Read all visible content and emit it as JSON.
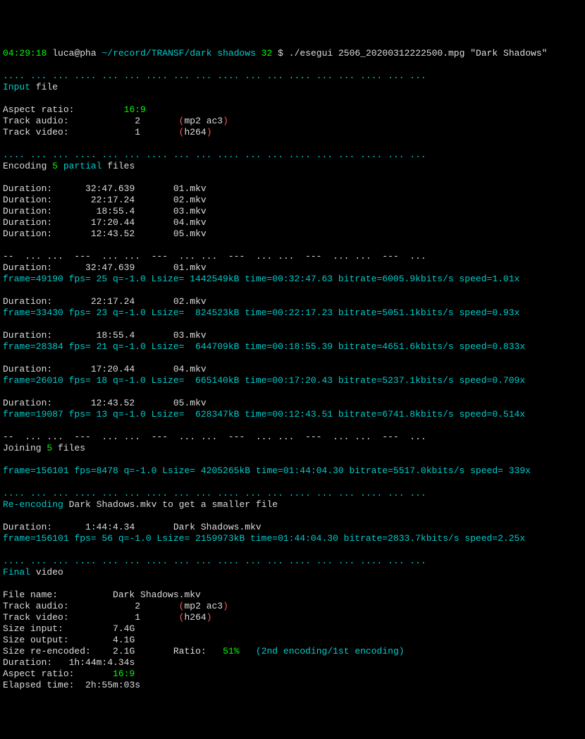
{
  "prompt": {
    "time": "04:29:18",
    "user": "luca@pha",
    "path": "~/record/TRANSF/dark shadows",
    "num": "32",
    "dollar": "$",
    "cmd": "./esegui 2506_20200312222500.mpg \"Dark Shadows\""
  },
  "dots": ".... ... ... .... ... ... .... ... ... .... ... ... .... ... ... .... ... ...",
  "section_input": {
    "label": "Input",
    "word": "file"
  },
  "aspect": {
    "label": "Aspect ratio:",
    "val": "16:9"
  },
  "track_audio": {
    "label": "Track audio:",
    "val": "2",
    "open": "(",
    "codecs": "mp2 ac3",
    "close": ")"
  },
  "track_video": {
    "label": "Track video:",
    "val": "1",
    "open": "(",
    "codecs": "h264",
    "close": ")"
  },
  "section_encoding": {
    "label": "Encoding",
    "num": "5",
    "word": "partial",
    "rest": "files"
  },
  "durations": [
    {
      "label": "Duration:",
      "time": "32:47.639",
      "file": "01.mkv"
    },
    {
      "label": "Duration:",
      "time": "22:17.24",
      "file": "02.mkv"
    },
    {
      "label": "Duration:",
      "time": "18:55.4",
      "file": "03.mkv"
    },
    {
      "label": "Duration:",
      "time": "17:20.44",
      "file": "04.mkv"
    },
    {
      "label": "Duration:",
      "time": "12:43.52",
      "file": "05.mkv"
    }
  ],
  "dashline": "--  ... ...  ---  ... ...  ---  ... ...  ---  ... ...  ---  ... ...  ---  ...",
  "progress": [
    {
      "dlabel": "Duration:",
      "dtime": "32:47.639",
      "dfile": "01.mkv",
      "stat": "frame=49190 fps= 25 q=-1.0 Lsize= 1442549kB time=00:32:47.63 bitrate=6005.9kbits/s speed=1.01x"
    },
    {
      "dlabel": "Duration:",
      "dtime": "22:17.24",
      "dfile": "02.mkv",
      "stat": "frame=33430 fps= 23 q=-1.0 Lsize=  824523kB time=00:22:17.23 bitrate=5051.1kbits/s speed=0.93x"
    },
    {
      "dlabel": "Duration:",
      "dtime": "18:55.4",
      "dfile": "03.mkv",
      "stat": "frame=28384 fps= 21 q=-1.0 Lsize=  644709kB time=00:18:55.39 bitrate=4651.6kbits/s speed=0.833x"
    },
    {
      "dlabel": "Duration:",
      "dtime": "17:20.44",
      "dfile": "04.mkv",
      "stat": "frame=26010 fps= 18 q=-1.0 Lsize=  665140kB time=00:17:20.43 bitrate=5237.1kbits/s speed=0.709x"
    },
    {
      "dlabel": "Duration:",
      "dtime": "12:43.52",
      "dfile": "05.mkv",
      "stat": "frame=19087 fps= 13 q=-1.0 Lsize=  628347kB time=00:12:43.51 bitrate=6741.8kbits/s speed=0.514x"
    }
  ],
  "section_joining": {
    "label": "Joining",
    "num": "5",
    "rest": "files"
  },
  "join_stat": "frame=156101 fps=8478 q=-1.0 Lsize= 4205265kB time=01:44:04.30 bitrate=5517.0kbits/s speed= 339x",
  "section_reenc": {
    "label": "Re-encoding",
    "file": "Dark Shadows.mkv",
    "rest": "to get a smaller file"
  },
  "reenc_dur": {
    "label": "Duration:",
    "time": "1:44:4.34",
    "file": "Dark Shadows.mkv"
  },
  "reenc_stat": "frame=156101 fps= 56 q=-1.0 Lsize= 2159973kB time=01:44:04.30 bitrate=2833.7kbits/s speed=2.25x",
  "section_final": {
    "label": "Final",
    "word": "video"
  },
  "final": {
    "filename_label": "File name:",
    "filename": "Dark Shadows.mkv",
    "ta_label": "Track audio:",
    "ta_val": "2",
    "ta_open": "(",
    "ta_codecs": "mp2 ac3",
    "ta_close": ")",
    "tv_label": "Track video:",
    "tv_val": "1",
    "tv_open": "(",
    "tv_codecs": "h264",
    "tv_close": ")",
    "si_label": "Size input:",
    "si_val": "7.4G",
    "so_label": "Size output:",
    "so_val": "4.1G",
    "sr_label": "Size re-encoded:",
    "sr_val": "2.1G",
    "ratio_label": "Ratio:",
    "ratio_val": "51%",
    "ratio_note": "(2nd encoding/1st encoding)",
    "dur_label": "Duration:",
    "dur_val": "1h:44m:4.34s",
    "ar_label": "Aspect ratio:",
    "ar_val": "16:9",
    "et_label": "Elapsed time:",
    "et_val": "2h:55m:03s"
  }
}
